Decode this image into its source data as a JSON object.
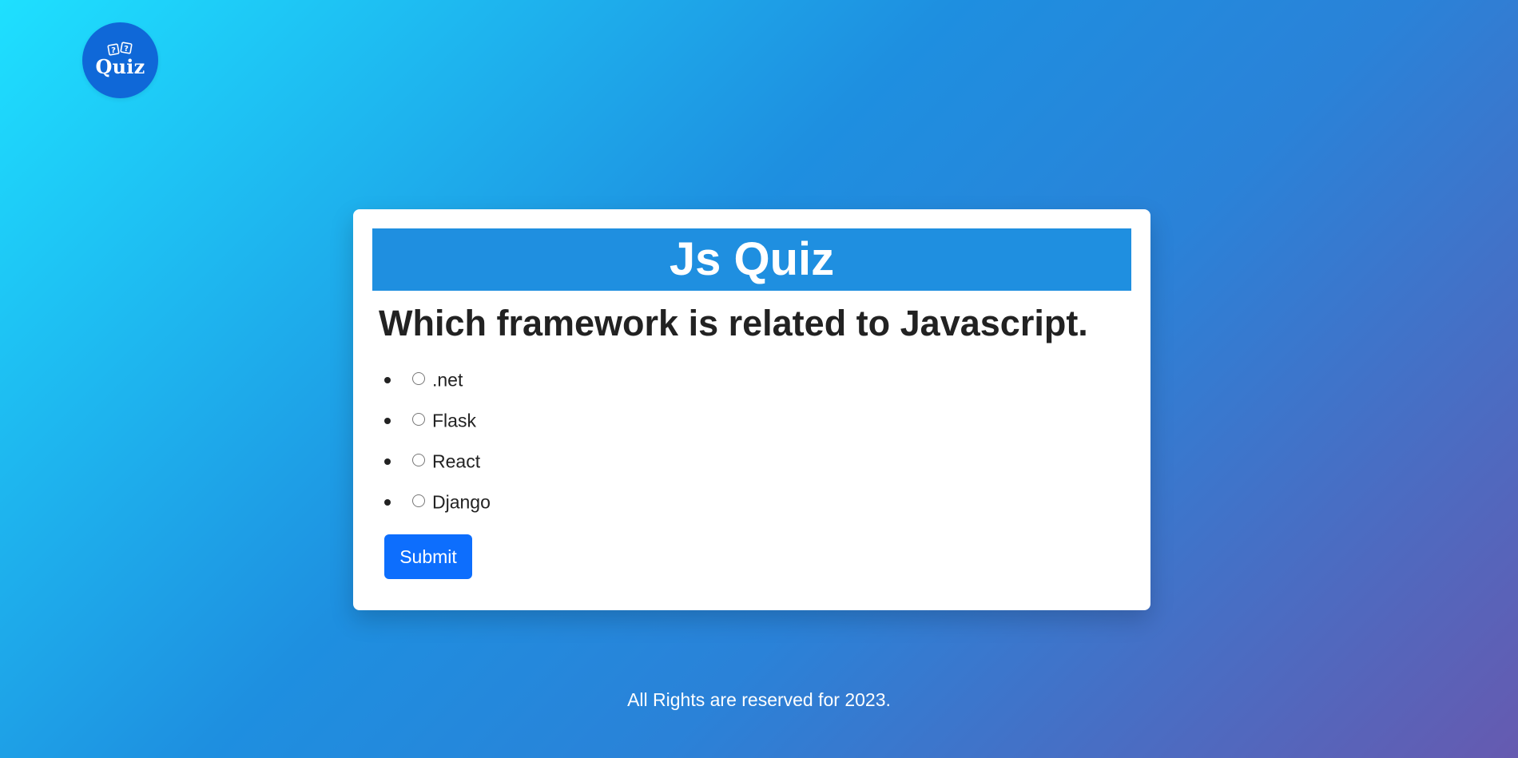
{
  "brand": {
    "logo_text": "Quiz",
    "logo_icon": "question-cards-icon",
    "logo_color": "#0f68d8"
  },
  "quiz": {
    "title": "Js Quiz",
    "header_color": "#1f8fe0",
    "question": "Which framework is related to Javascript.",
    "options": [
      {
        "label": ".net"
      },
      {
        "label": "Flask"
      },
      {
        "label": "React"
      },
      {
        "label": "Django"
      }
    ],
    "submit_label": "Submit",
    "submit_color": "#0d6efd"
  },
  "footer": {
    "text": "All Rights are reserved for 2023."
  }
}
